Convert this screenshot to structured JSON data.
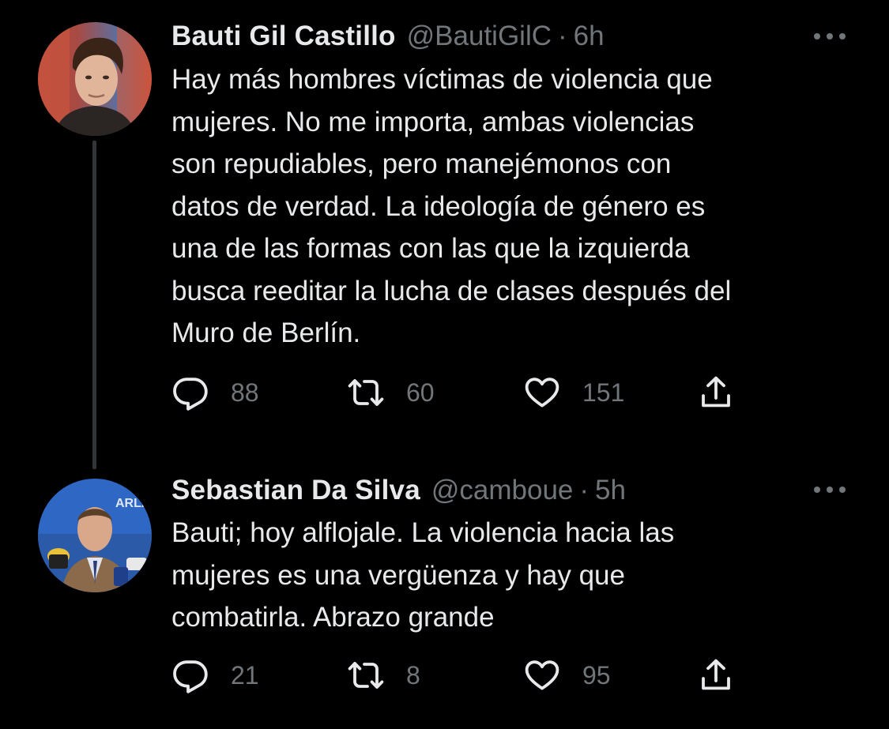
{
  "colors": {
    "background": "#000000",
    "primary_text": "#e7e9ea",
    "secondary_text": "#71767b",
    "thread_line": "#333639"
  },
  "tweets": [
    {
      "display_name": "Bauti Gil Castillo",
      "handle": "@BautiGilC",
      "separator": "·",
      "time": "6h",
      "text_lines": [
        "Hay más hombres víctimas de violencia que",
        "mujeres. No me importa, ambas violencias",
        "son repudiables, pero manejémonos con",
        "datos de verdad. La ideología de género es",
        "una de las formas con las que la izquierda",
        "busca reeditar la lucha de clases después del",
        "Muro de Berlín."
      ],
      "replies": "88",
      "retweets": "60",
      "likes": "151",
      "icons": [
        "reply-icon",
        "retweet-icon",
        "like-icon",
        "share-icon",
        "more-icon"
      ]
    },
    {
      "display_name": "Sebastian Da Silva",
      "handle": "@camboue",
      "separator": "·",
      "time": "5h",
      "text_lines": [
        "Bauti; hoy alflojale. La violencia hacia las",
        "mujeres es una vergüenza y hay que",
        "combatirla. Abrazo grande"
      ],
      "replies": "21",
      "retweets": "8",
      "likes": "95",
      "icons": [
        "reply-icon",
        "retweet-icon",
        "like-icon",
        "share-icon",
        "more-icon"
      ]
    }
  ]
}
